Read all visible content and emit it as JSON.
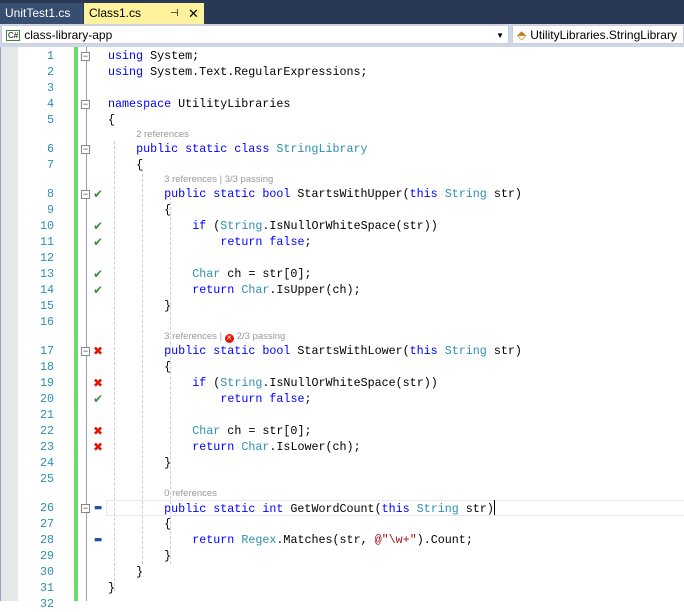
{
  "tabs": [
    {
      "label": "UnitTest1.cs",
      "active": false
    },
    {
      "label": "Class1.cs",
      "active": true
    }
  ],
  "nav": {
    "project": "class-library-app",
    "project_icon": "C#",
    "scope": "UtilityLibraries.StringLibrary"
  },
  "colors": {
    "keyword": "#0000ff",
    "type": "#2b91af",
    "string": "#a31515",
    "pass": "#3a8f3a",
    "fail": "#e51400"
  },
  "lines": [
    {
      "n": "1",
      "fold": true,
      "tokens": [
        [
          "k",
          "using"
        ],
        [
          "p",
          " System;"
        ]
      ]
    },
    {
      "n": "2",
      "tokens": [
        [
          "k",
          "using"
        ],
        [
          "p",
          " System.Text.RegularExpressions;"
        ]
      ]
    },
    {
      "n": "3",
      "tokens": []
    },
    {
      "n": "4",
      "fold": true,
      "tokens": [
        [
          "k",
          "namespace"
        ],
        [
          "p",
          " UtilityLibraries"
        ]
      ]
    },
    {
      "n": "5",
      "tokens": [
        [
          "p",
          "{"
        ]
      ]
    },
    {
      "lens": "2 references",
      "indent": 1
    },
    {
      "n": "6",
      "fold": true,
      "indent": 1,
      "tokens": [
        [
          "k",
          "public static class "
        ],
        [
          "t",
          "StringLibrary"
        ]
      ]
    },
    {
      "n": "7",
      "indent": 1,
      "tokens": [
        [
          "p",
          "{"
        ]
      ]
    },
    {
      "lens": "3 references | 3/3 passing",
      "indent": 2
    },
    {
      "n": "8",
      "fold": true,
      "status": "pass",
      "indent": 2,
      "tokens": [
        [
          "k",
          "public static bool "
        ],
        [
          "p",
          "StartsWithUpper("
        ],
        [
          "k",
          "this "
        ],
        [
          "t",
          "String"
        ],
        [
          "p",
          " str)"
        ]
      ]
    },
    {
      "n": "9",
      "indent": 2,
      "tokens": [
        [
          "p",
          "{"
        ]
      ]
    },
    {
      "n": "10",
      "status": "pass",
      "indent": 3,
      "tokens": [
        [
          "k",
          "if "
        ],
        [
          "p",
          "("
        ],
        [
          "t",
          "String"
        ],
        [
          "p",
          ".IsNullOrWhiteSpace(str))"
        ]
      ]
    },
    {
      "n": "11",
      "status": "pass",
      "indent": 4,
      "tokens": [
        [
          "k",
          "return false"
        ],
        [
          "p",
          ";"
        ]
      ]
    },
    {
      "n": "12",
      "tokens": []
    },
    {
      "n": "13",
      "status": "pass",
      "indent": 3,
      "tokens": [
        [
          "t",
          "Char"
        ],
        [
          "p",
          " ch = str[0];"
        ]
      ]
    },
    {
      "n": "14",
      "status": "pass",
      "indent": 3,
      "tokens": [
        [
          "k",
          "return "
        ],
        [
          "t",
          "Char"
        ],
        [
          "p",
          ".IsUpper(ch);"
        ]
      ]
    },
    {
      "n": "15",
      "indent": 2,
      "tokens": [
        [
          "p",
          "}"
        ]
      ]
    },
    {
      "n": "16",
      "tokens": []
    },
    {
      "lens": "3 references | ",
      "lens_fail": "2/3 passing",
      "indent": 2
    },
    {
      "n": "17",
      "fold": true,
      "status": "fail",
      "indent": 2,
      "tokens": [
        [
          "k",
          "public static bool "
        ],
        [
          "p",
          "StartsWithLower("
        ],
        [
          "k",
          "this "
        ],
        [
          "t",
          "String"
        ],
        [
          "p",
          " str)"
        ]
      ]
    },
    {
      "n": "18",
      "indent": 2,
      "tokens": [
        [
          "p",
          "{"
        ]
      ]
    },
    {
      "n": "19",
      "status": "fail",
      "indent": 3,
      "tokens": [
        [
          "k",
          "if "
        ],
        [
          "p",
          "("
        ],
        [
          "t",
          "String"
        ],
        [
          "p",
          ".IsNullOrWhiteSpace(str))"
        ]
      ]
    },
    {
      "n": "20",
      "status": "pass",
      "indent": 4,
      "tokens": [
        [
          "k",
          "return false"
        ],
        [
          "p",
          ";"
        ]
      ]
    },
    {
      "n": "21",
      "tokens": []
    },
    {
      "n": "22",
      "status": "fail",
      "indent": 3,
      "tokens": [
        [
          "t",
          "Char"
        ],
        [
          "p",
          " ch = str[0];"
        ]
      ]
    },
    {
      "n": "23",
      "status": "fail",
      "indent": 3,
      "tokens": [
        [
          "k",
          "return "
        ],
        [
          "t",
          "Char"
        ],
        [
          "p",
          ".IsLower(ch);"
        ]
      ]
    },
    {
      "n": "24",
      "indent": 2,
      "tokens": [
        [
          "p",
          "}"
        ]
      ]
    },
    {
      "n": "25",
      "tokens": []
    },
    {
      "lens": "0 references",
      "indent": 2
    },
    {
      "n": "26",
      "fold": true,
      "status": "none",
      "current": true,
      "indent": 2,
      "tokens": [
        [
          "k",
          "public static int "
        ],
        [
          "p",
          "GetWordCount("
        ],
        [
          "k",
          "this "
        ],
        [
          "t",
          "String"
        ],
        [
          "p",
          " str)"
        ]
      ]
    },
    {
      "n": "27",
      "indent": 2,
      "tokens": [
        [
          "p",
          "{"
        ]
      ]
    },
    {
      "n": "28",
      "status": "none",
      "indent": 3,
      "tokens": [
        [
          "k",
          "return "
        ],
        [
          "t",
          "Regex"
        ],
        [
          "p",
          ".Matches(str, "
        ],
        [
          "s",
          "@\"\\w+\""
        ],
        [
          "p",
          ").Count;"
        ]
      ]
    },
    {
      "n": "29",
      "indent": 2,
      "tokens": [
        [
          "p",
          "}"
        ]
      ]
    },
    {
      "n": "30",
      "indent": 1,
      "tokens": [
        [
          "p",
          "}"
        ]
      ]
    },
    {
      "n": "31",
      "tokens": [
        [
          "p",
          "}"
        ]
      ]
    },
    {
      "n": "32",
      "tokens": []
    }
  ]
}
